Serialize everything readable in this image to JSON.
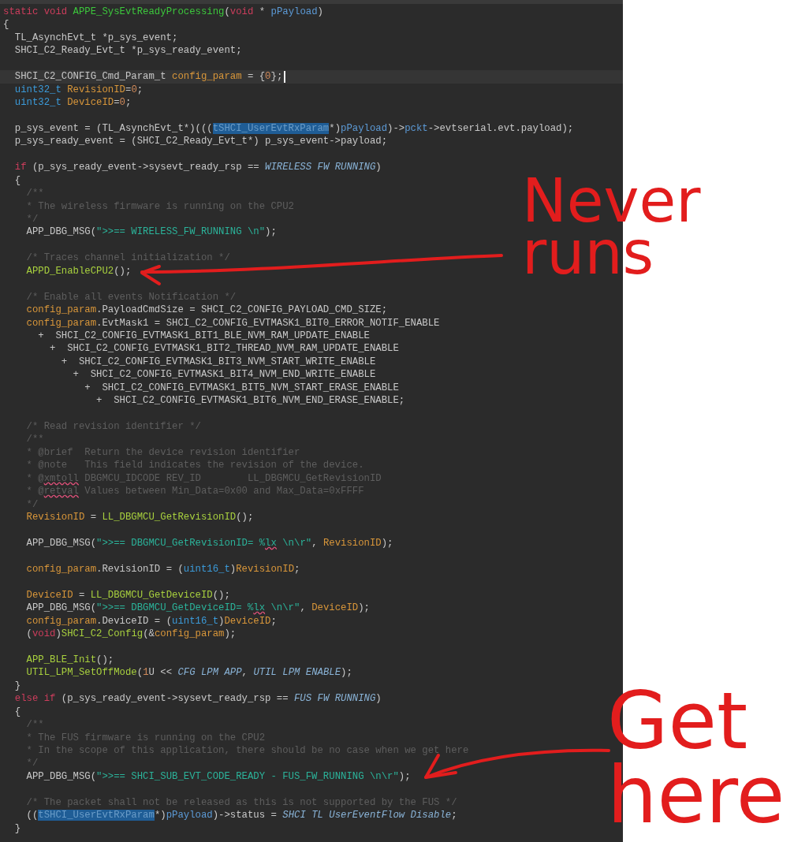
{
  "editor": {
    "lines": [
      {
        "current": false,
        "tokens": [
          {
            "kind": "keyword",
            "text": "static void "
          },
          {
            "kind": "function_def",
            "text": "APPE_SysEvtReadyProcessing"
          },
          {
            "kind": "plain",
            "text": "("
          },
          {
            "kind": "keyword",
            "text": "void"
          },
          {
            "kind": "plain",
            "text": " * "
          },
          {
            "kind": "param",
            "text": "pPayload"
          },
          {
            "kind": "plain",
            "text": ")"
          }
        ]
      },
      {
        "current": false,
        "tokens": [
          {
            "kind": "plain",
            "text": "{"
          }
        ]
      },
      {
        "current": false,
        "tokens": [
          {
            "kind": "plain",
            "text": "  TL_AsynchEvt_t *p_sys_event;"
          }
        ]
      },
      {
        "current": false,
        "tokens": [
          {
            "kind": "plain",
            "text": "  SHCI_C2_Ready_Evt_t *p_sys_ready_event;"
          }
        ]
      },
      {
        "current": false
      },
      {
        "current": true,
        "tokens": [
          {
            "kind": "plain",
            "text": "  SHCI_C2_CONFIG_Cmd_Param_t "
          },
          {
            "kind": "variable",
            "text": "config_param"
          },
          {
            "kind": "plain",
            "text": " = {"
          },
          {
            "kind": "number",
            "text": "0"
          },
          {
            "kind": "plain",
            "text": "};"
          }
        ]
      },
      {
        "current": false,
        "tokens": [
          {
            "kind": "type",
            "text": "  uint32_t"
          },
          {
            "kind": "variable",
            "text": " RevisionID"
          },
          {
            "kind": "plain",
            "text": "="
          },
          {
            "kind": "number",
            "text": "0"
          },
          {
            "kind": "plain",
            "text": ";"
          }
        ]
      },
      {
        "current": false,
        "tokens": [
          {
            "kind": "type",
            "text": "  uint32_t"
          },
          {
            "kind": "variable",
            "text": " DeviceID"
          },
          {
            "kind": "plain",
            "text": "="
          },
          {
            "kind": "number",
            "text": "0"
          },
          {
            "kind": "plain",
            "text": ";"
          }
        ]
      },
      {
        "current": false
      },
      {
        "current": false,
        "tokens": [
          {
            "kind": "plain",
            "text": "  p_sys_event = (TL_AsynchEvt_t*)((("
          },
          {
            "kind": "selection",
            "text": "tSHCI_UserEvtRxParam"
          },
          {
            "kind": "plain",
            "text": "*)"
          },
          {
            "kind": "param",
            "text": "pPayload"
          },
          {
            "kind": "plain",
            "text": ")->"
          },
          {
            "kind": "param",
            "text": "pckt"
          },
          {
            "kind": "plain",
            "text": "->evtserial.evt.payload);"
          }
        ]
      },
      {
        "current": false,
        "tokens": [
          {
            "kind": "plain",
            "text": "  p_sys_ready_event = (SHCI_C2_Ready_Evt_t*) p_sys_event->payload;"
          }
        ]
      },
      {
        "current": false
      },
      {
        "current": false,
        "tokens": [
          {
            "kind": "keyword",
            "text": "  if"
          },
          {
            "kind": "plain",
            "text": " (p_sys_ready_event->sysevt_ready_rsp == "
          },
          {
            "kind": "macro",
            "text": "WIRELESS FW RUNNING"
          },
          {
            "kind": "plain",
            "text": ")"
          }
        ]
      },
      {
        "current": false,
        "tokens": [
          {
            "kind": "plain",
            "text": "  {"
          }
        ]
      },
      {
        "current": false,
        "tokens": [
          {
            "kind": "comment",
            "text": "    /**"
          }
        ]
      },
      {
        "current": false,
        "tokens": [
          {
            "kind": "comment",
            "text": "    * The wireless firmware is running on the CPU2"
          }
        ]
      },
      {
        "current": false,
        "tokens": [
          {
            "kind": "comment",
            "text": "    */"
          }
        ]
      },
      {
        "current": false,
        "tokens": [
          {
            "kind": "plain",
            "text": "    APP_DBG_MSG("
          },
          {
            "kind": "string",
            "text": "\">>== WIRELESS_FW_RUNNING \\n\""
          },
          {
            "kind": "plain",
            "text": ");"
          }
        ]
      },
      {
        "current": false
      },
      {
        "current": false,
        "tokens": [
          {
            "kind": "comment",
            "text": "    /* Traces channel initialization */"
          }
        ]
      },
      {
        "current": false,
        "tokens": [
          {
            "kind": "function",
            "text": "    APPD_EnableCPU2"
          },
          {
            "kind": "plain",
            "text": "();"
          }
        ]
      },
      {
        "current": false
      },
      {
        "current": false,
        "tokens": [
          {
            "kind": "comment",
            "text": "    /* Enable all events Notification */"
          }
        ]
      },
      {
        "current": false,
        "tokens": [
          {
            "kind": "variable",
            "text": "    config_param"
          },
          {
            "kind": "plain",
            "text": ".PayloadCmdSize = SHCI_C2_CONFIG_PAYLOAD_CMD_SIZE;"
          }
        ]
      },
      {
        "current": false,
        "tokens": [
          {
            "kind": "variable",
            "text": "    config_param"
          },
          {
            "kind": "plain",
            "text": ".EvtMask1 = SHCI_C2_CONFIG_EVTMASK1_BIT0_ERROR_NOTIF_ENABLE"
          }
        ]
      },
      {
        "current": false,
        "tokens": [
          {
            "kind": "plain",
            "text": "      +  SHCI_C2_CONFIG_EVTMASK1_BIT1_BLE_NVM_RAM_UPDATE_ENABLE"
          }
        ]
      },
      {
        "current": false,
        "tokens": [
          {
            "kind": "plain",
            "text": "        +  SHCI_C2_CONFIG_EVTMASK1_BIT2_THREAD_NVM_RAM_UPDATE_ENABLE"
          }
        ]
      },
      {
        "current": false,
        "tokens": [
          {
            "kind": "plain",
            "text": "          +  SHCI_C2_CONFIG_EVTMASK1_BIT3_NVM_START_WRITE_ENABLE"
          }
        ]
      },
      {
        "current": false,
        "tokens": [
          {
            "kind": "plain",
            "text": "            +  SHCI_C2_CONFIG_EVTMASK1_BIT4_NVM_END_WRITE_ENABLE"
          }
        ]
      },
      {
        "current": false,
        "tokens": [
          {
            "kind": "plain",
            "text": "              +  SHCI_C2_CONFIG_EVTMASK1_BIT5_NVM_START_ERASE_ENABLE"
          }
        ]
      },
      {
        "current": false,
        "tokens": [
          {
            "kind": "plain",
            "text": "                +  SHCI_C2_CONFIG_EVTMASK1_BIT6_NVM_END_ERASE_ENABLE;"
          }
        ]
      },
      {
        "current": false
      },
      {
        "current": false,
        "tokens": [
          {
            "kind": "comment",
            "text": "    /* Read revision identifier */"
          }
        ]
      },
      {
        "current": false,
        "tokens": [
          {
            "kind": "comment",
            "text": "    /**"
          }
        ]
      },
      {
        "current": false,
        "tokens": [
          {
            "kind": "comment",
            "text": "    * @brief  Return the device revision identifier"
          }
        ]
      },
      {
        "current": false,
        "tokens": [
          {
            "kind": "comment",
            "text": "    * @note   This field indicates the revision of the device."
          }
        ]
      },
      {
        "current": false,
        "tokens": [
          {
            "kind": "comment",
            "text": "    * @"
          },
          {
            "kind": "comment_misspelled",
            "text": "xmtoll"
          },
          {
            "kind": "comment",
            "text": " DBGMCU_IDCODE REV_ID        LL_DBGMCU_GetRevisionID"
          }
        ]
      },
      {
        "current": false,
        "tokens": [
          {
            "kind": "comment",
            "text": "    * @"
          },
          {
            "kind": "comment_misspelled",
            "text": "retval"
          },
          {
            "kind": "comment",
            "text": " Values between Min_Data=0x00 and Max_Data=0xFFFF"
          }
        ]
      },
      {
        "current": false,
        "tokens": [
          {
            "kind": "comment",
            "text": "    */"
          }
        ]
      },
      {
        "current": false,
        "tokens": [
          {
            "kind": "variable",
            "text": "    RevisionID"
          },
          {
            "kind": "plain",
            "text": " = "
          },
          {
            "kind": "function",
            "text": "LL_DBGMCU_GetRevisionID"
          },
          {
            "kind": "plain",
            "text": "();"
          }
        ]
      },
      {
        "current": false
      },
      {
        "current": false,
        "tokens": [
          {
            "kind": "plain",
            "text": "    APP_DBG_MSG("
          },
          {
            "kind": "string",
            "text": "\">>== DBGMCU_GetRevisionID= %"
          },
          {
            "kind": "string_misspelled",
            "text": "lx"
          },
          {
            "kind": "string",
            "text": " \\n\\r\""
          },
          {
            "kind": "plain",
            "text": ", "
          },
          {
            "kind": "variable",
            "text": "RevisionID"
          },
          {
            "kind": "plain",
            "text": ");"
          }
        ]
      },
      {
        "current": false
      },
      {
        "current": false,
        "tokens": [
          {
            "kind": "variable",
            "text": "    config_param"
          },
          {
            "kind": "plain",
            "text": ".RevisionID = ("
          },
          {
            "kind": "type",
            "text": "uint16_t"
          },
          {
            "kind": "plain",
            "text": ")"
          },
          {
            "kind": "variable",
            "text": "RevisionID"
          },
          {
            "kind": "plain",
            "text": ";"
          }
        ]
      },
      {
        "current": false
      },
      {
        "current": false,
        "tokens": [
          {
            "kind": "variable",
            "text": "    DeviceID"
          },
          {
            "kind": "plain",
            "text": " = "
          },
          {
            "kind": "function",
            "text": "LL_DBGMCU_GetDeviceID"
          },
          {
            "kind": "plain",
            "text": "();"
          }
        ]
      },
      {
        "current": false,
        "tokens": [
          {
            "kind": "plain",
            "text": "    APP_DBG_MSG("
          },
          {
            "kind": "string",
            "text": "\">>== DBGMCU_GetDeviceID= %"
          },
          {
            "kind": "string_misspelled",
            "text": "lx"
          },
          {
            "kind": "string",
            "text": " \\n\\r\""
          },
          {
            "kind": "plain",
            "text": ", "
          },
          {
            "kind": "variable",
            "text": "DeviceID"
          },
          {
            "kind": "plain",
            "text": ");"
          }
        ]
      },
      {
        "current": false,
        "tokens": [
          {
            "kind": "variable",
            "text": "    config_param"
          },
          {
            "kind": "plain",
            "text": ".DeviceID = ("
          },
          {
            "kind": "type",
            "text": "uint16_t"
          },
          {
            "kind": "plain",
            "text": ")"
          },
          {
            "kind": "variable",
            "text": "DeviceID"
          },
          {
            "kind": "plain",
            "text": ";"
          }
        ]
      },
      {
        "current": false,
        "tokens": [
          {
            "kind": "plain",
            "text": "    ("
          },
          {
            "kind": "keyword",
            "text": "void"
          },
          {
            "kind": "plain",
            "text": ")"
          },
          {
            "kind": "function",
            "text": "SHCI_C2_Config"
          },
          {
            "kind": "plain",
            "text": "(&"
          },
          {
            "kind": "variable",
            "text": "config_param"
          },
          {
            "kind": "plain",
            "text": ");"
          }
        ]
      },
      {
        "current": false
      },
      {
        "current": false,
        "tokens": [
          {
            "kind": "function",
            "text": "    APP_BLE_Init"
          },
          {
            "kind": "plain",
            "text": "();"
          }
        ]
      },
      {
        "current": false,
        "tokens": [
          {
            "kind": "function",
            "text": "    UTIL_LPM_SetOffMode"
          },
          {
            "kind": "plain",
            "text": "("
          },
          {
            "kind": "number",
            "text": "1"
          },
          {
            "kind": "plain",
            "text": "U << "
          },
          {
            "kind": "macro",
            "text": "CFG LPM APP"
          },
          {
            "kind": "plain",
            "text": ", "
          },
          {
            "kind": "macro",
            "text": "UTIL LPM ENABLE"
          },
          {
            "kind": "plain",
            "text": ");"
          }
        ]
      },
      {
        "current": false,
        "tokens": [
          {
            "kind": "plain",
            "text": "  }"
          }
        ]
      },
      {
        "current": false,
        "tokens": [
          {
            "kind": "keyword",
            "text": "  else if"
          },
          {
            "kind": "plain",
            "text": " (p_sys_ready_event->sysevt_ready_rsp == "
          },
          {
            "kind": "macro",
            "text": "FUS FW RUNNING"
          },
          {
            "kind": "plain",
            "text": ")"
          }
        ]
      },
      {
        "current": false,
        "tokens": [
          {
            "kind": "plain",
            "text": "  {"
          }
        ]
      },
      {
        "current": false,
        "tokens": [
          {
            "kind": "comment",
            "text": "    /**"
          }
        ]
      },
      {
        "current": false,
        "tokens": [
          {
            "kind": "comment",
            "text": "    * The FUS firmware is running on the CPU2"
          }
        ]
      },
      {
        "current": false,
        "tokens": [
          {
            "kind": "comment",
            "text": "    * In the scope of this application, there should be no case when we get here"
          }
        ]
      },
      {
        "current": false,
        "tokens": [
          {
            "kind": "comment",
            "text": "    */"
          }
        ]
      },
      {
        "current": false,
        "tokens": [
          {
            "kind": "plain",
            "text": "    APP_DBG_MSG("
          },
          {
            "kind": "string",
            "text": "\">>== SHCI_SUB_EVT_CODE_READY - FUS_FW_RUNNING \\n\\r\""
          },
          {
            "kind": "plain",
            "text": ");"
          }
        ]
      },
      {
        "current": false
      },
      {
        "current": false,
        "tokens": [
          {
            "kind": "comment",
            "text": "    /* The packet shall not be released as this is not supported by the FUS */"
          }
        ]
      },
      {
        "current": false,
        "tokens": [
          {
            "kind": "plain",
            "text": "    (("
          },
          {
            "kind": "selection",
            "text": "tSHCI_UserEvtRxParam"
          },
          {
            "kind": "plain",
            "text": "*)"
          },
          {
            "kind": "param",
            "text": "pPayload"
          },
          {
            "kind": "plain",
            "text": ")->status = "
          },
          {
            "kind": "macro",
            "text": "SHCI TL UserEventFlow Disable"
          },
          {
            "kind": "plain",
            "text": ";"
          }
        ]
      },
      {
        "current": false,
        "tokens": [
          {
            "kind": "plain",
            "text": "  }"
          }
        ]
      }
    ]
  },
  "annotations": [
    {
      "text": "Never runs"
    },
    {
      "text": "Get here"
    }
  ]
}
